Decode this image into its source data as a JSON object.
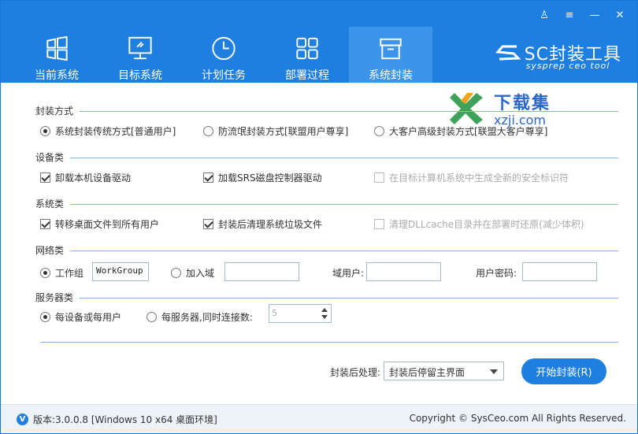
{
  "window_controls": {
    "user": "♙",
    "menu": "≡",
    "minimize": "—",
    "close": "✕"
  },
  "tabs": [
    {
      "label": "当前系统",
      "icon": "windows-icon"
    },
    {
      "label": "目标系统",
      "icon": "monitor-icon"
    },
    {
      "label": "计划任务",
      "icon": "clock-icon"
    },
    {
      "label": "部署过程",
      "icon": "grid-icon"
    },
    {
      "label": "系统封装",
      "icon": "package-icon",
      "active": true
    }
  ],
  "brand": {
    "name": "SC封装工具",
    "sub": "sysprep ceo tool"
  },
  "watermark": {
    "title": "下载集",
    "url": "xzji.com"
  },
  "sections": {
    "package_mode": {
      "title": "封装方式",
      "options": [
        "系统封装传统方式[普通用户]",
        "防流氓封装方式[联盟用户尊享]",
        "大客户高级封装方式[联盟大客户尊享]"
      ],
      "selected": 0
    },
    "device": {
      "title": "设备类",
      "options": [
        "卸载本机设备驱动",
        "加载SRS磁盘控制器驱动",
        "在目标计算机系统中生成全新的安全标识符"
      ]
    },
    "system": {
      "title": "系统类",
      "options": [
        "转移桌面文件到所有用户",
        "封装后清理系统垃圾文件",
        "清理DLLcache目录并在部署时还原(减少体积)"
      ]
    },
    "network": {
      "title": "网络类",
      "workgroup_label": "工作组",
      "workgroup_value": "WorkGroup",
      "domain_label": "加入域",
      "domain_value": "",
      "domain_user_label": "域用户:",
      "domain_user_value": "",
      "password_label": "用户密码:",
      "password_value": ""
    },
    "server": {
      "title": "服务器类",
      "opt1": "每设备或每用户",
      "opt2": "每服务器,同时连接数:",
      "connections": "5"
    }
  },
  "after_package": {
    "label": "封装后处理:",
    "value": "封装后停留主界面"
  },
  "start_button": "开始封装(R)",
  "footer": {
    "version": "版本:3.0.0.8 [Windows 10 x64 桌面环境]",
    "copyright": "Copyright © SysCeo.com All Rights Reserved."
  },
  "colors": {
    "accent": "#1f7fe0",
    "active_tab": "#3d95ea"
  }
}
